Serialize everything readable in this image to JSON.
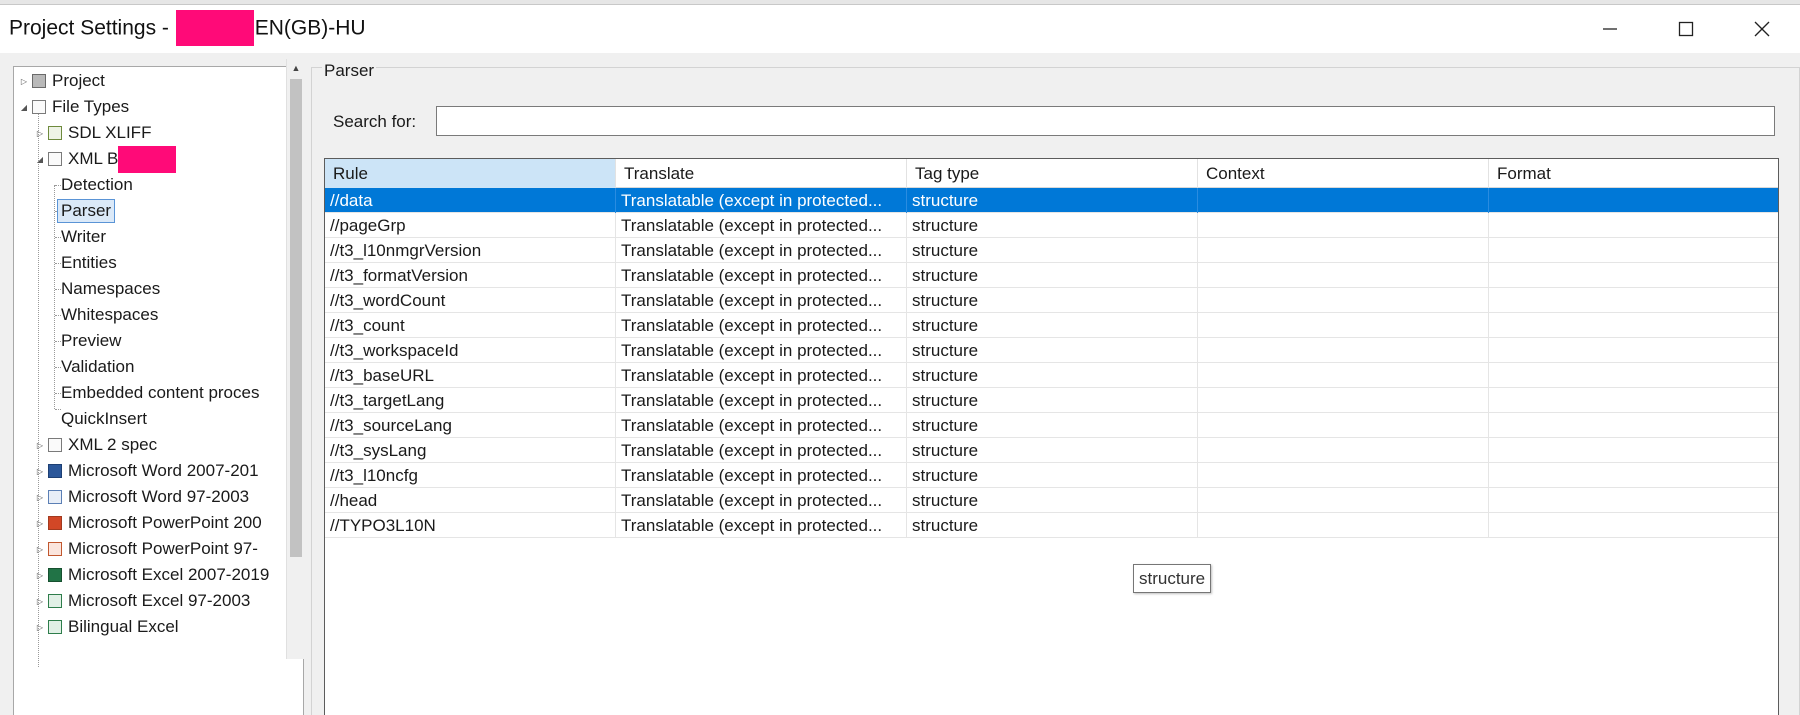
{
  "window": {
    "title_prefix": "Project Settings - ",
    "title_suffix": "EN(GB)-HU",
    "controls": [
      "minimize-icon",
      "maximize-icon",
      "close-icon"
    ]
  },
  "tree": {
    "items": [
      {
        "label": "Project",
        "icon": "project-icon"
      },
      {
        "label": "File Types",
        "icon": "file-types-icon"
      },
      {
        "label": "SDL XLIFF",
        "icon": "sdl-xliff-icon"
      },
      {
        "label": "XML B",
        "icon": "xml-file-icon"
      },
      {
        "label": "Detection"
      },
      {
        "label": "Parser"
      },
      {
        "label": "Writer"
      },
      {
        "label": "Entities"
      },
      {
        "label": "Namespaces"
      },
      {
        "label": "Whitespaces"
      },
      {
        "label": "Preview"
      },
      {
        "label": "Validation"
      },
      {
        "label": "Embedded content proces"
      },
      {
        "label": "QuickInsert"
      },
      {
        "label": "XML 2 spec",
        "icon": "xml-file-icon"
      },
      {
        "label": "Microsoft Word 2007-201",
        "icon": "word-icon"
      },
      {
        "label": "Microsoft Word 97-2003",
        "icon": "word-legacy-icon"
      },
      {
        "label": "Microsoft PowerPoint 200",
        "icon": "powerpoint-icon"
      },
      {
        "label": "Microsoft PowerPoint 97-",
        "icon": "powerpoint-legacy-icon"
      },
      {
        "label": "Microsoft Excel 2007-2019",
        "icon": "excel-icon"
      },
      {
        "label": "Microsoft Excel 97-2003",
        "icon": "excel-legacy-icon"
      },
      {
        "label": "Bilingual Excel",
        "icon": "bilingual-excel-icon"
      }
    ],
    "selected": "Parser"
  },
  "parser": {
    "group_title": "Parser",
    "search_label": "Search for:",
    "search_value": ""
  },
  "table": {
    "columns": [
      "Rule",
      "Translate",
      "Tag type",
      "Context",
      "Format"
    ],
    "rows": [
      {
        "rule": "//data",
        "translate": "Translatable (except in protected...",
        "tag_type": "structure",
        "context": "",
        "format": ""
      },
      {
        "rule": "//pageGrp",
        "translate": "Translatable (except in protected...",
        "tag_type": "structure",
        "context": "",
        "format": ""
      },
      {
        "rule": "//t3_l10nmgrVersion",
        "translate": "Translatable (except in protected...",
        "tag_type": "structure",
        "context": "",
        "format": ""
      },
      {
        "rule": "//t3_formatVersion",
        "translate": "Translatable (except in protected...",
        "tag_type": "structure",
        "context": "",
        "format": ""
      },
      {
        "rule": "//t3_wordCount",
        "translate": "Translatable (except in protected...",
        "tag_type": "structure",
        "context": "",
        "format": ""
      },
      {
        "rule": "//t3_count",
        "translate": "Translatable (except in protected...",
        "tag_type": "structure",
        "context": "",
        "format": ""
      },
      {
        "rule": "//t3_workspaceId",
        "translate": "Translatable (except in protected...",
        "tag_type": "structure",
        "context": "",
        "format": ""
      },
      {
        "rule": "//t3_baseURL",
        "translate": "Translatable (except in protected...",
        "tag_type": "structure",
        "context": "",
        "format": ""
      },
      {
        "rule": "//t3_targetLang",
        "translate": "Translatable (except in protected...",
        "tag_type": "structure",
        "context": "",
        "format": ""
      },
      {
        "rule": "//t3_sourceLang",
        "translate": "Translatable (except in protected...",
        "tag_type": "structure",
        "context": "",
        "format": ""
      },
      {
        "rule": "//t3_sysLang",
        "translate": "Translatable (except in protected...",
        "tag_type": "structure",
        "context": "",
        "format": ""
      },
      {
        "rule": "//t3_l10ncfg",
        "translate": "Translatable (except in protected...",
        "tag_type": "structure",
        "context": "",
        "format": ""
      },
      {
        "rule": "//head",
        "translate": "Translatable (except in protected...",
        "tag_type": "structure",
        "context": "",
        "format": ""
      },
      {
        "rule": "//TYPO3L10N",
        "translate": "Translatable (except in protected...",
        "tag_type": "structure",
        "context": "",
        "format": ""
      }
    ],
    "selected_row": 0
  },
  "tooltip": {
    "text": "structure"
  },
  "colors": {
    "selection": "#0078d7",
    "sorted_header": "#cce4f7",
    "redaction": "#ff0a78"
  }
}
